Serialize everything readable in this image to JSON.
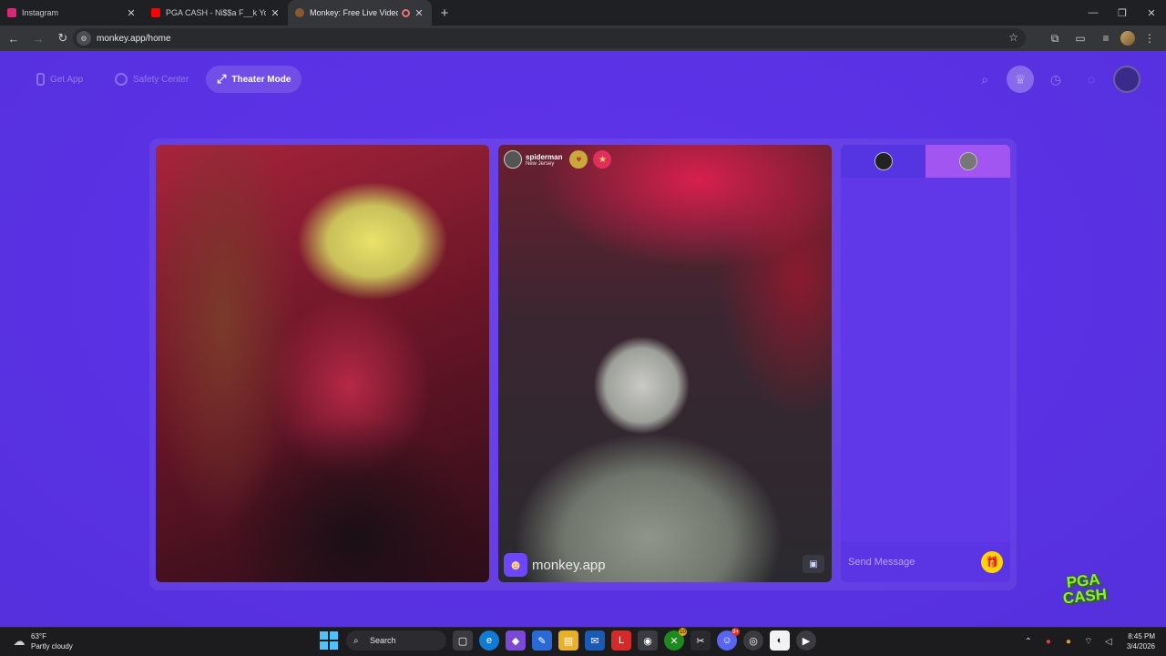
{
  "browser": {
    "tabs": [
      {
        "title": "Instagram",
        "favicon_color": "#d62976",
        "active": false
      },
      {
        "title": "PGA CASH - Ni$$a F__k You Fr",
        "favicon_color": "#ff0000",
        "active": false
      },
      {
        "title": "Monkey: Free Live Video Ch",
        "favicon_color": "#8a5a2a",
        "active": true
      }
    ],
    "new_tab_icon": "plus-icon",
    "address": "monkey.app/home"
  },
  "page": {
    "nav": {
      "get_app": "Get App",
      "safety_center": "Safety Center",
      "theater_mode": "Theater Mode"
    },
    "remote_user": {
      "name": "spiderman",
      "location": "New Jersey"
    },
    "watermark": "monkey.app",
    "chat": {
      "placeholder": "Send Message"
    },
    "overlay_logo": {
      "line1": "PGA",
      "line2": "CASH"
    },
    "colors": {
      "page_bg": "#5a31e3",
      "accent_tab": "#a255f0",
      "gift": "#ffd400"
    }
  },
  "taskbar": {
    "weather_temp": "63°F",
    "weather_desc": "Partly cloudy",
    "search_label": "Search",
    "time": "8:45 PM",
    "date": "3/4/2026",
    "badges": {
      "xbox": "10",
      "discord": "9+"
    }
  }
}
